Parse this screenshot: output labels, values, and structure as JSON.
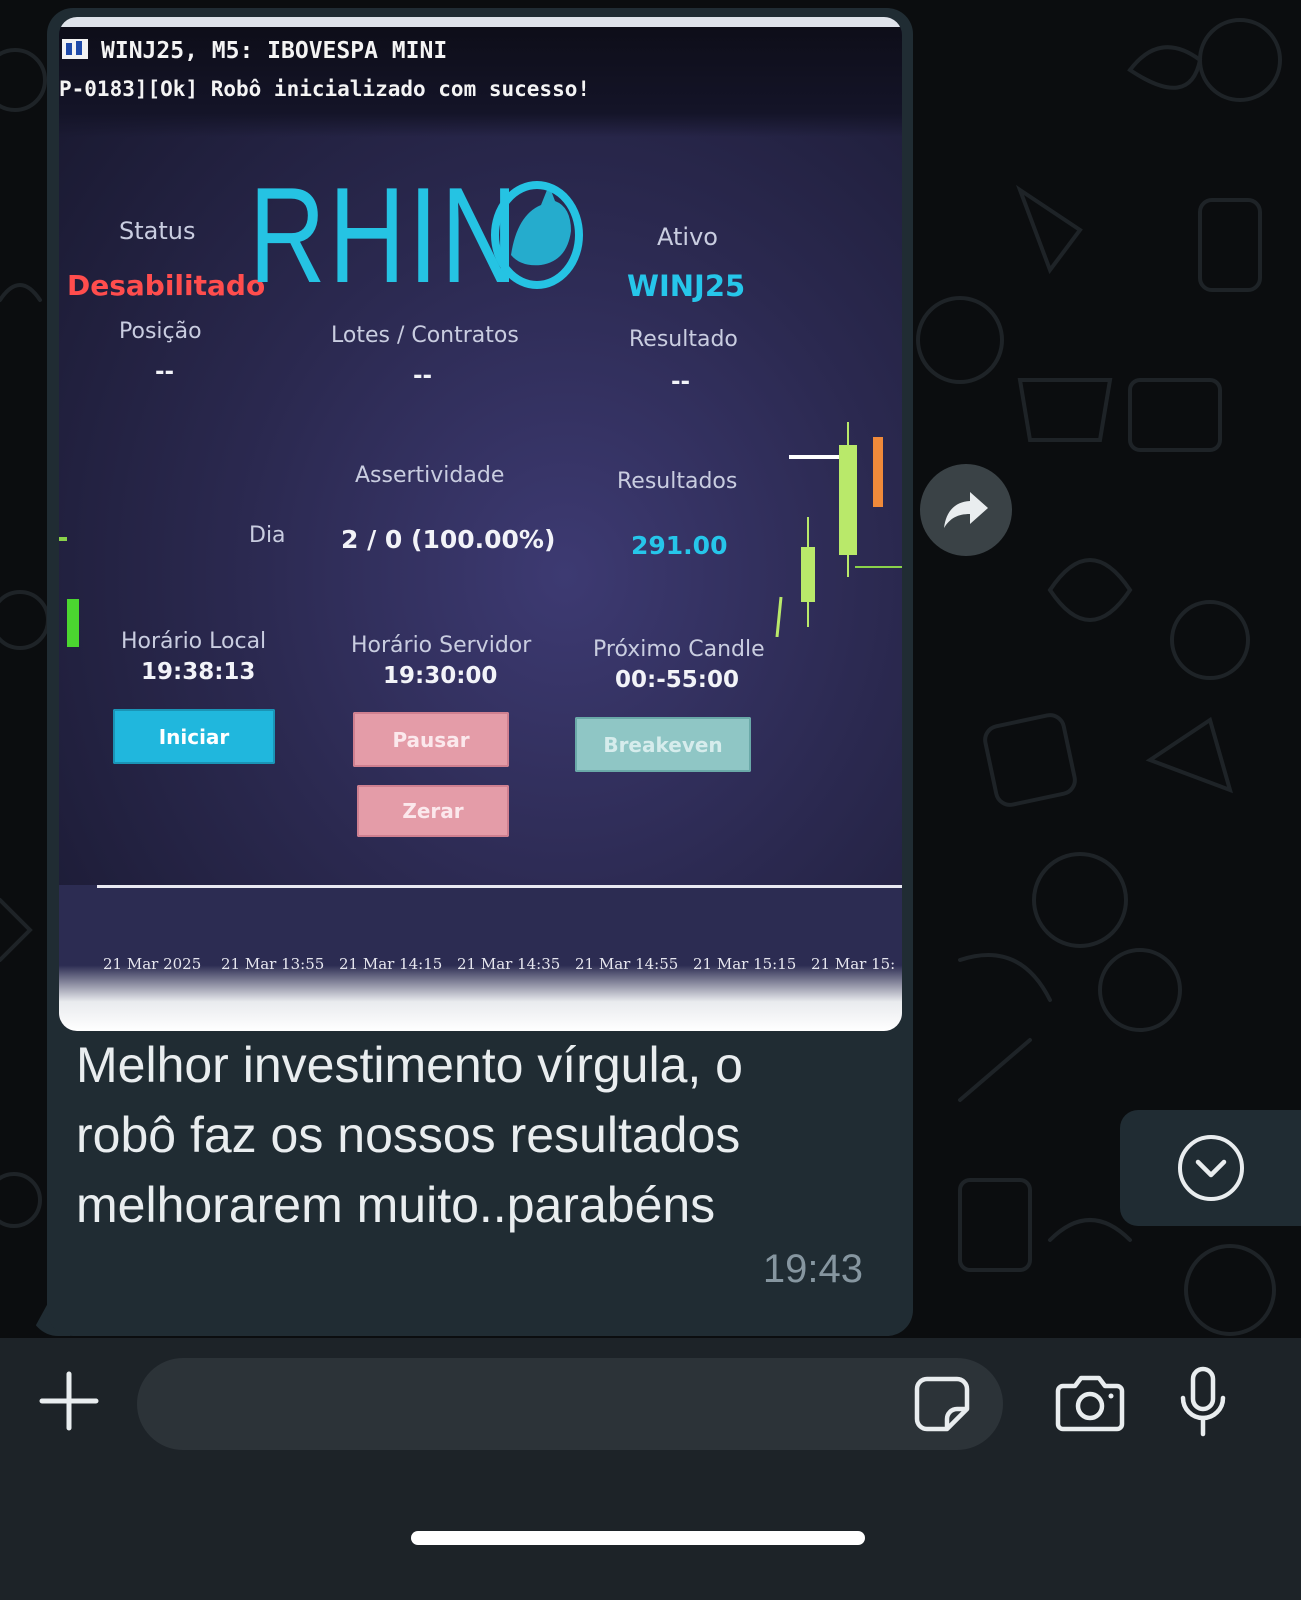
{
  "photo": {
    "terminal_title": "WINJ25, M5: IBOVESPA MINI",
    "terminal_log": "P-0183][Ok] Robô inicializado com sucesso!",
    "logo_text": "RHIN",
    "status_label": "Status",
    "status_value": "Desabilitado",
    "ativo_label": "Ativo",
    "ativo_value": "WINJ25",
    "posicao_label": "Posição",
    "posicao_value": "--",
    "lotes_label": "Lotes / Contratos",
    "lotes_value": "--",
    "resultado_label": "Resultado",
    "resultado_value": "--",
    "assertividade_label": "Assertividade",
    "resultados_label": "Resultados",
    "dia_label": "Dia",
    "dia_assertividade": "2 / 0 (100.00%)",
    "dia_resultados": "291.00",
    "horario_local_label": "Horário Local",
    "horario_local_value": "19:38:13",
    "horario_servidor_label": "Horário Servidor",
    "horario_servidor_value": "19:30:00",
    "proximo_candle_label": "Próximo Candle",
    "proximo_candle_value": "00:-55:00",
    "buttons": {
      "iniciar": "Iniciar",
      "pausar": "Pausar",
      "zerar": "Zerar",
      "breakeven": "Breakeven"
    },
    "axis_labels": [
      "21 Mar 2025",
      "21 Mar 13:55",
      "21 Mar 14:15",
      "21 Mar 14:35",
      "21 Mar 14:55",
      "21 Mar 15:15",
      "21 Mar 15:"
    ],
    "colors": {
      "accent": "#25c3e3",
      "status_red": "#ff4d4d",
      "pausar": "#e49ca8",
      "iniciar": "#20b7dd"
    }
  },
  "message": {
    "lines": [
      "Melhor investimento vírgula, o",
      "robô faz os nossos resultados",
      "melhorarem muito..parabéns"
    ],
    "time": "19:43"
  },
  "composer": {
    "placeholder": "",
    "icons": [
      "plus-icon",
      "sticker-icon",
      "camera-icon",
      "microphone-icon"
    ]
  },
  "colors": {
    "bubble": "#202c33",
    "chat_background": "#0b0d0f",
    "bottom_bar": "#1d2328",
    "text": "#e9edef",
    "meta_text": "#8696a0"
  }
}
